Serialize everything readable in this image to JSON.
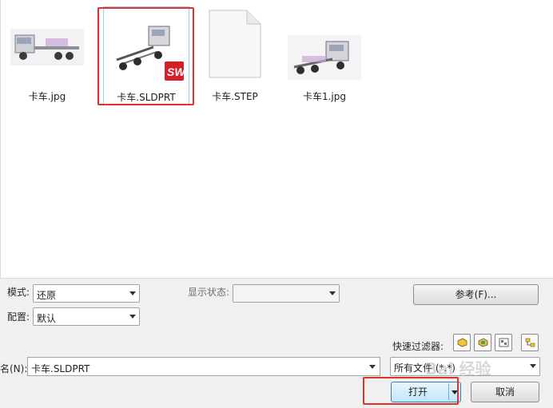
{
  "files": [
    {
      "name": "卡车.jpg"
    },
    {
      "name": "卡车.SLDPRT",
      "selected": true
    },
    {
      "name": "卡车.STEP"
    },
    {
      "name": "卡车1.jpg"
    }
  ],
  "options": {
    "mode_label": "模式:",
    "mode_value": "还原",
    "display_state_label": "显示状态:",
    "display_state_value": "",
    "config_label": "配置:",
    "config_value": "默认",
    "reference_button": "参考(F)..."
  },
  "filters": {
    "label": "快速过滤器:"
  },
  "filename": {
    "label": "名(N):",
    "value": "卡车.SLDPRT",
    "filetype_value": "所有文件 (*.*)"
  },
  "buttons": {
    "open": "打开",
    "cancel": "取消"
  },
  "watermark": "Bai 经验",
  "colors": {
    "highlight": "#e0312e",
    "selection": "#99c8f0",
    "panel": "#f0f0f0"
  }
}
